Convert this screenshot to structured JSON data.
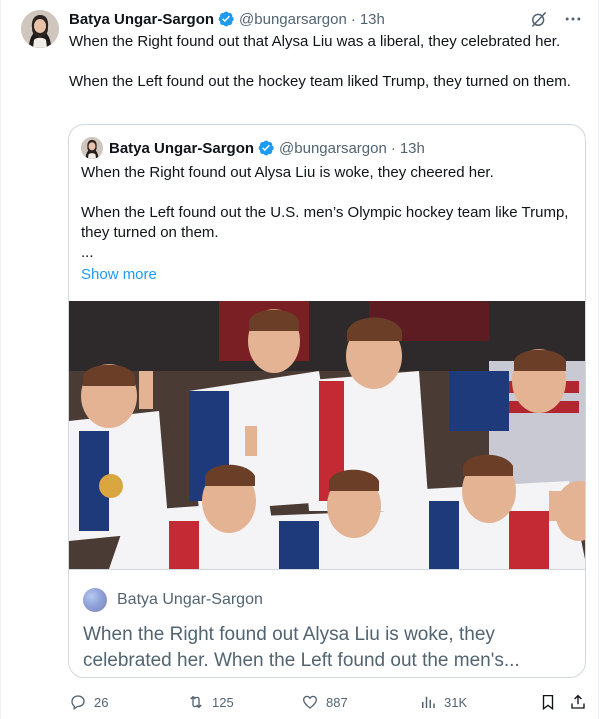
{
  "tweet": {
    "author_name": "Batya Ungar-Sargon",
    "handle": "@bungarsargon",
    "separator": "·",
    "time": "13h",
    "text_1": "When the Right found out that Alysa Liu was a liberal, they celebrated her.",
    "text_2": "When the Left found out the hockey team liked Trump, they turned on them."
  },
  "quote": {
    "author_name": "Batya Ungar-Sargon",
    "handle": "@bungarsargon",
    "separator": "·",
    "time": "13h",
    "text_1": "When the Right found out Alysa Liu is woke, they cheered her.",
    "text_2": "When the Left found out the U.S. men’s Olympic hockey team like Trump, they turned on them.",
    "ellipsis": "...",
    "show_more": "Show more"
  },
  "card": {
    "source": "Batya Ungar-Sargon",
    "title": "When the Right found out Alysa Liu is woke, they celebrated her. When the Left found out the men's..."
  },
  "actions": {
    "replies": "26",
    "reposts": "125",
    "likes": "887",
    "views": "31K"
  },
  "colors": {
    "accent": "#1d9bf0",
    "verified": "#1d9bf0",
    "secondary_text": "#536471",
    "border": "#cfd9de"
  },
  "icons": [
    "verified-badge-icon",
    "grok-icon",
    "more-icon",
    "reply-icon",
    "repost-icon",
    "like-icon",
    "views-icon",
    "bookmark-icon",
    "share-icon"
  ]
}
